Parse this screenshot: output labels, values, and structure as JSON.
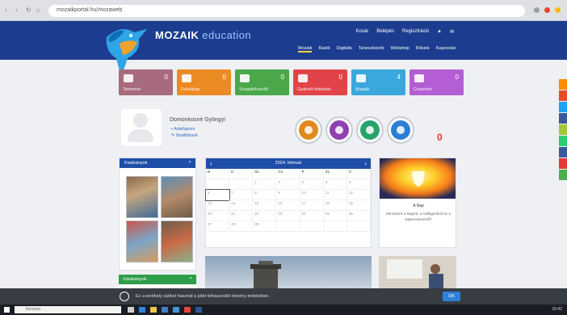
{
  "browser": {
    "url": "mozaikportal.hu/mozaweb"
  },
  "header": {
    "brand": "MOZAIK",
    "brand_suffix": "education",
    "top_links": [
      "Kosár",
      "Belépés",
      "Regisztráció",
      "▲",
      "✉"
    ],
    "menu": [
      "Mozaik",
      "Kiadó",
      "Digitális",
      "Taneszközök",
      "Webshop",
      "Rólunk",
      "Kapcsolat"
    ]
  },
  "tiles": [
    {
      "label": "Tanmenet",
      "count": "0",
      "color": "#a86b7d"
    },
    {
      "label": "Feladatlap",
      "count": "0",
      "color": "#ec8a24"
    },
    {
      "label": "Vizsgafelkészítő",
      "count": "0",
      "color": "#4aa84b"
    },
    {
      "label": "Gyakorló feladatok",
      "count": "0",
      "color": "#e14448"
    },
    {
      "label": "Mappák",
      "count": "4",
      "color": "#3aa8dc"
    },
    {
      "label": "Csoportok",
      "count": "0",
      "color": "#b35ed4"
    }
  ],
  "profile": {
    "name": "Domonkosné Gyöngyi",
    "link1": "Adatlapom",
    "link2": "Beállítások"
  },
  "badges": {
    "colors": [
      "#e08a1c",
      "#8e3fb0",
      "#27a36b",
      "#2d7fd6"
    ],
    "count": "0"
  },
  "left_panel": {
    "title": "Kiadványok",
    "footer_title": "Kiadványok"
  },
  "calendar": {
    "title": "2024. február",
    "days": [
      "H",
      "K",
      "Sz",
      "Cs",
      "P",
      "Sz",
      "V"
    ],
    "dates": [
      "",
      "",
      "1",
      "2",
      "3",
      "4",
      "5",
      "6",
      "7",
      "8",
      "9",
      "10",
      "11",
      "12",
      "13",
      "14",
      "15",
      "16",
      "17",
      "18",
      "19",
      "20",
      "21",
      "22",
      "23",
      "24",
      "25",
      "26",
      "27",
      "28",
      "29",
      "",
      "",
      "",
      ""
    ]
  },
  "right_panel": {
    "title": "A Nap",
    "caption": "Mit tudunk a Napról, a csillagunkról és a Naprendszerről?"
  },
  "cookie": {
    "text": "Ez a webhely sütiket használ a jobb felhasználói élmény érdekében.",
    "button": "OK"
  },
  "taskbar": {
    "search_placeholder": "Keresés",
    "time": "10:42"
  },
  "sidebar_colors": [
    "#ff8a00",
    "#e44d26",
    "#1da1f2",
    "#3b5998",
    "#a4c639",
    "#2ecc71",
    "#3b5998",
    "#e53935",
    "#4caf50"
  ]
}
